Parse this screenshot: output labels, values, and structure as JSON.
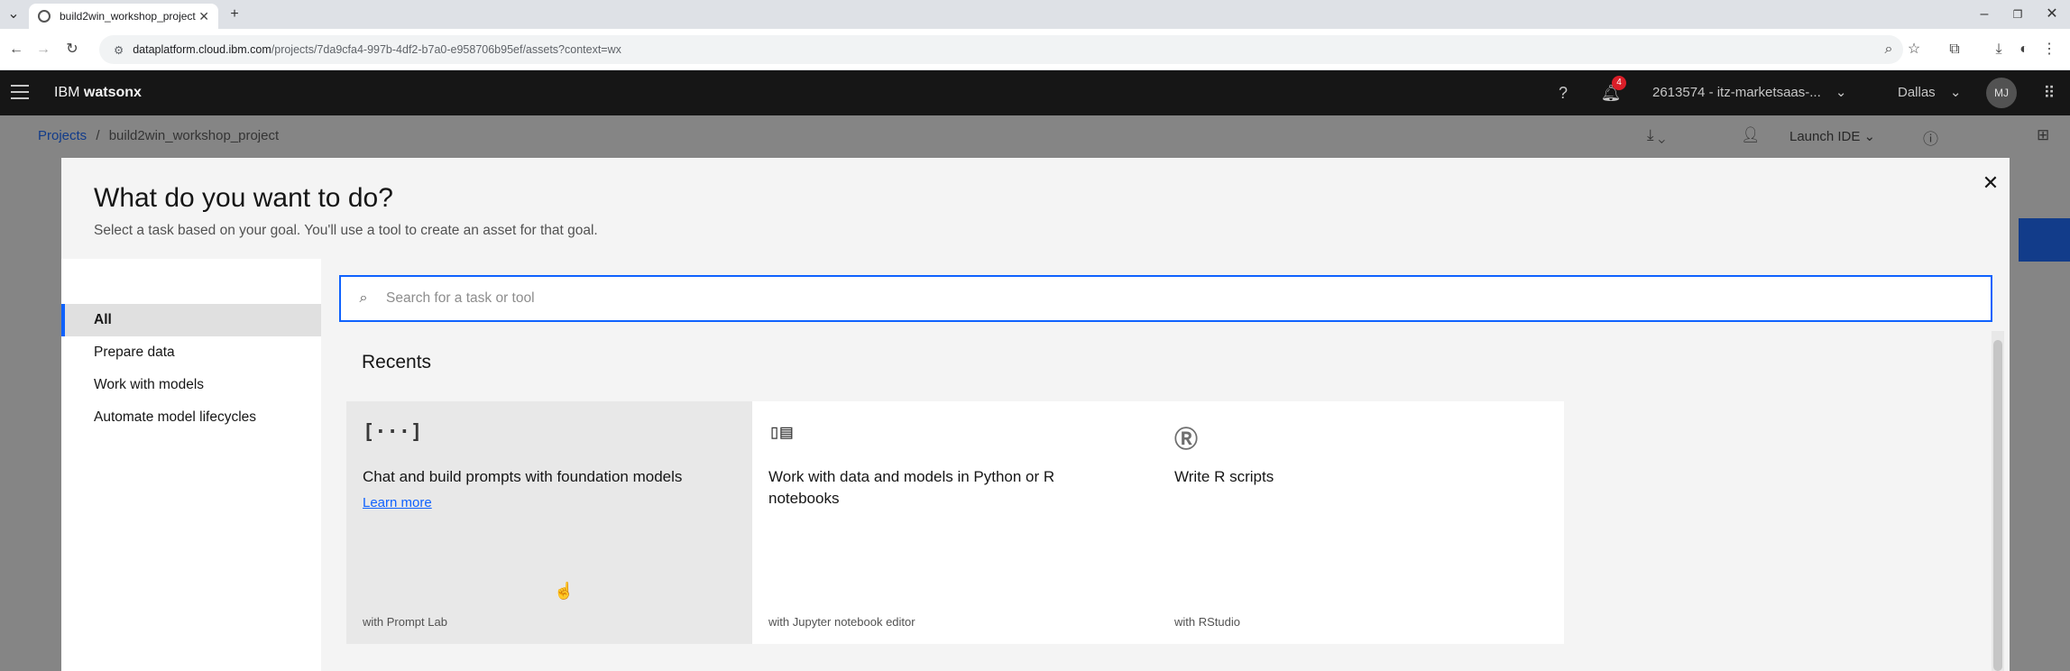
{
  "browser": {
    "tab_title": "build2win_workshop_project –",
    "url_host": "dataplatform.cloud.ibm.com",
    "url_path": "/projects/7da9cfa4-997b-4df2-b7a0-e958706b95ef/assets?context=wx"
  },
  "header": {
    "brand_prefix": "IBM ",
    "brand_name": "watsonx",
    "notification_count": "4",
    "account": "2613574 - itz-marketsaas-...",
    "region": "Dallas",
    "avatar_initials": "MJ"
  },
  "breadcrumb": {
    "projects": "Projects",
    "separator": "/",
    "project": "build2win_workshop_project"
  },
  "project_toolbar": {
    "launch_ide": "Launch IDE"
  },
  "modal": {
    "title": "What do you want to do?",
    "subtitle": "Select a task based on your goal. You'll use a tool to create an asset for that goal.",
    "sidebar": [
      {
        "label": "All",
        "active": true
      },
      {
        "label": "Prepare data"
      },
      {
        "label": "Work with models"
      },
      {
        "label": "Automate model lifecycles"
      }
    ],
    "search_placeholder": "Search for a task or tool",
    "section_title": "Recents",
    "cards": [
      {
        "icon": "[···]",
        "icon_name": "prompt-lab-icon",
        "title": "Chat and build prompts with foundation models",
        "link": "Learn more",
        "tool": "with Prompt Lab"
      },
      {
        "icon": "▯▤",
        "icon_name": "notebook-icon",
        "title": "Work with data and models in Python or R notebooks",
        "tool": "with Jupyter notebook editor"
      },
      {
        "icon": "Ⓡ",
        "icon_name": "rstudio-icon",
        "title": "Write R scripts",
        "tool": "with RStudio"
      }
    ]
  }
}
